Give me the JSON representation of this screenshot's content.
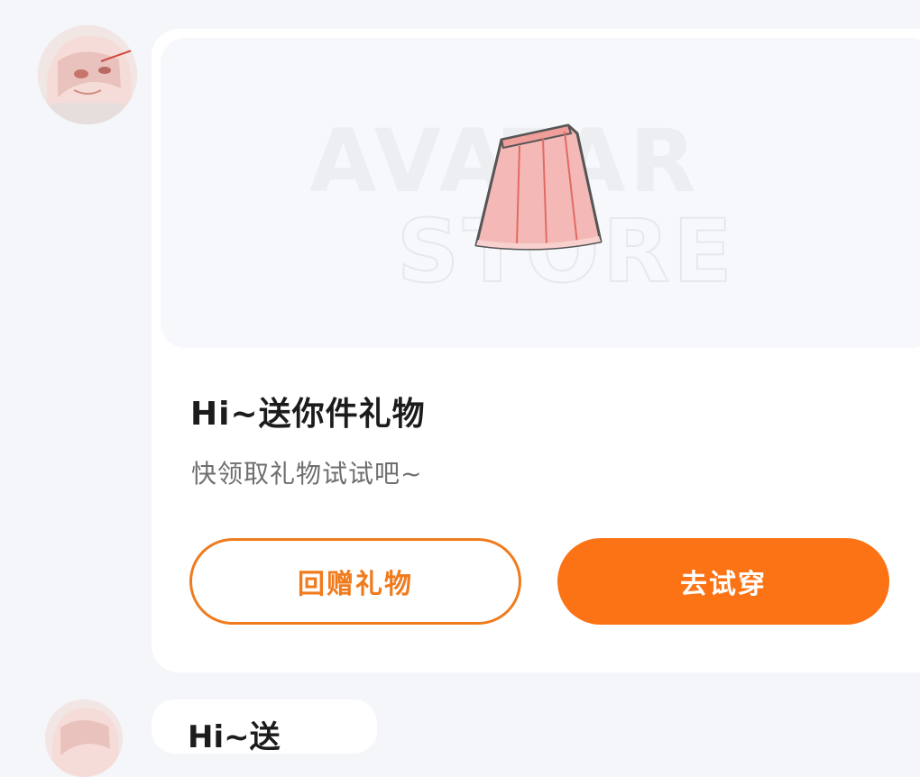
{
  "message": {
    "title": "Hi~送你件礼物",
    "subtitle": "快领取礼物试试吧~",
    "gift_item": "skirt-icon",
    "watermark_line1": "AVATAR",
    "watermark_line2": "STORE",
    "buttons": {
      "return_gift": "回赠礼物",
      "try_on": "去试穿"
    }
  },
  "next_message": {
    "text": "Hi~送"
  },
  "colors": {
    "accent": "#fb7314",
    "outline": "#f07b1d",
    "background": "#f4f6f9",
    "card": "#ffffff"
  }
}
